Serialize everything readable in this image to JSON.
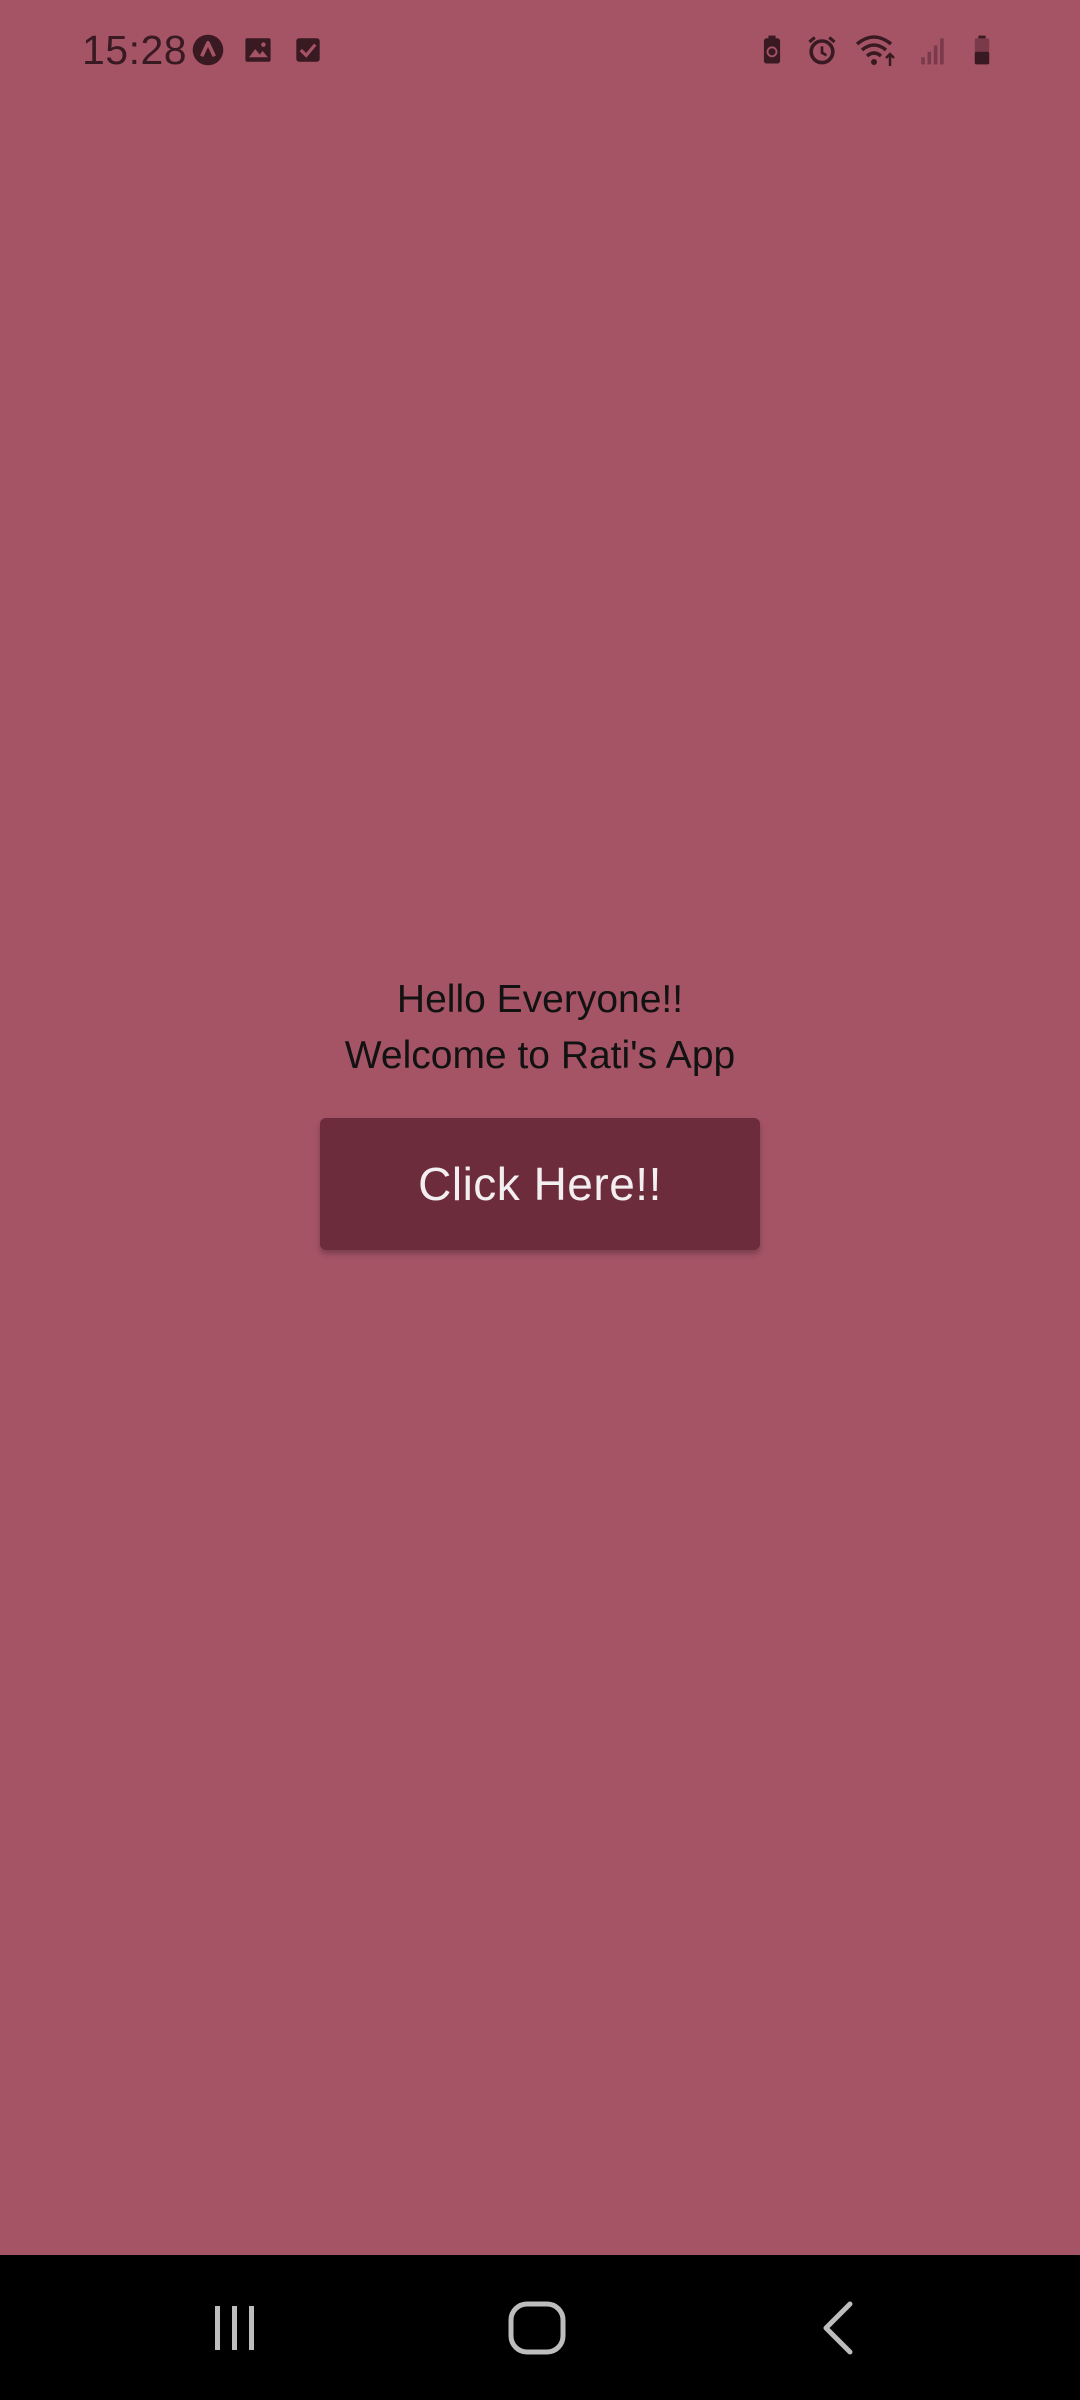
{
  "status_bar": {
    "time": "15:28",
    "left_icons": [
      "app-notification-icon",
      "gallery-icon",
      "checkbox-icon"
    ],
    "right_icons": [
      "battery-saver-icon",
      "alarm-icon",
      "wifi-icon",
      "signal-icon",
      "battery-icon"
    ]
  },
  "main": {
    "greeting": "Hello Everyone!!",
    "welcome": "Welcome to Rati's App",
    "button_label": "Click Here!!"
  },
  "nav_bar": {
    "buttons": [
      "recents-icon",
      "home-icon",
      "back-icon"
    ]
  },
  "colors": {
    "background": "#a55466",
    "button": "#6d2c3c",
    "button_text": "#f3eef0",
    "text": "#121212",
    "nav_bar": "#000000"
  }
}
